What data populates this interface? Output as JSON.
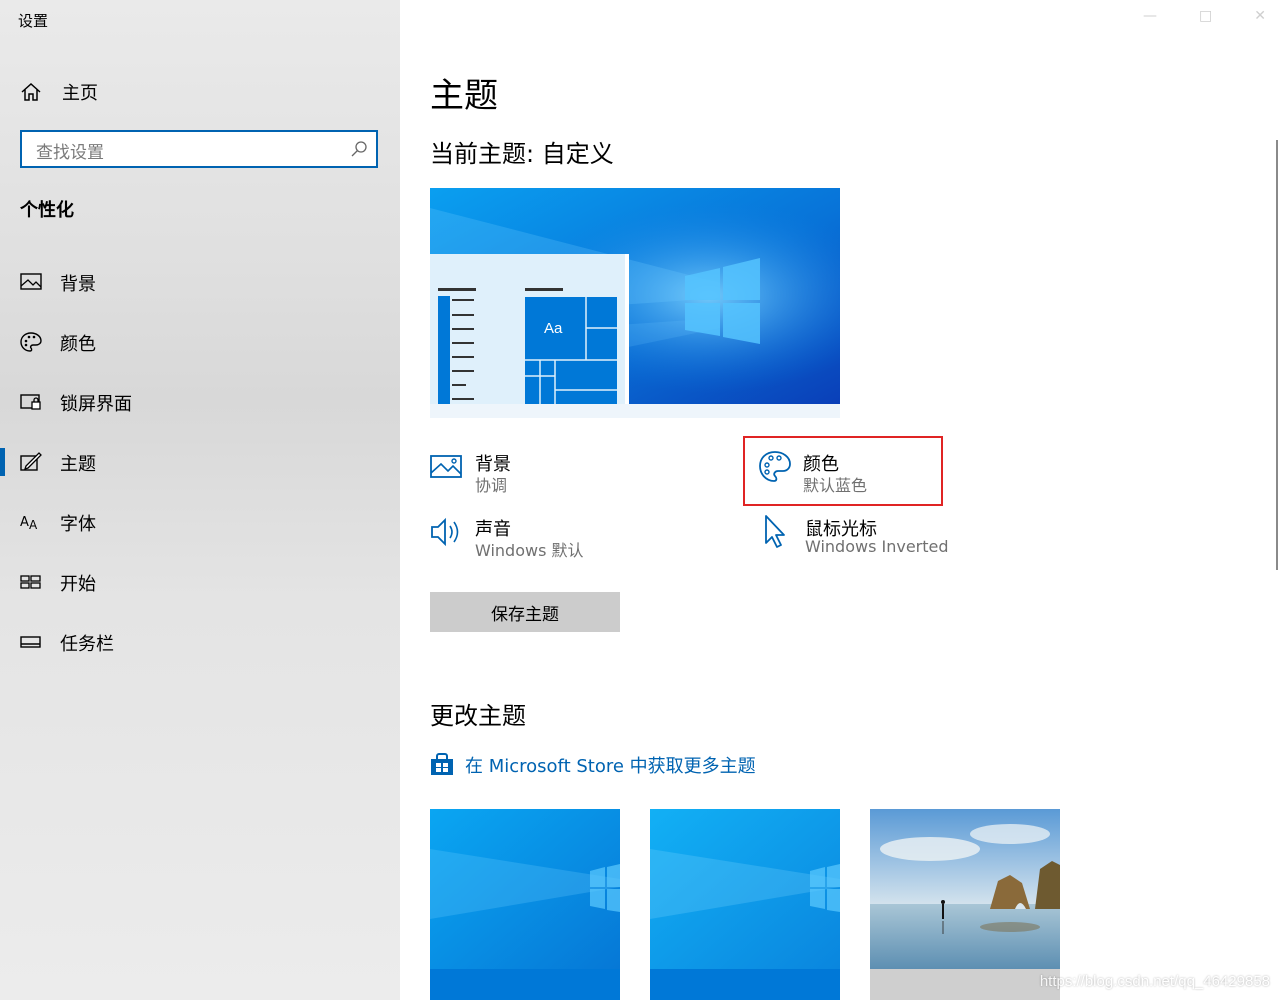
{
  "window": {
    "title": "设置"
  },
  "sidebar": {
    "home_label": "主页",
    "search_placeholder": "查找设置",
    "section_title": "个性化",
    "items": [
      {
        "label": "背景",
        "icon": "image-icon"
      },
      {
        "label": "颜色",
        "icon": "palette-icon"
      },
      {
        "label": "锁屏界面",
        "icon": "lock-screen-icon"
      },
      {
        "label": "主题",
        "icon": "theme-icon",
        "active": true
      },
      {
        "label": "字体",
        "icon": "font-icon"
      },
      {
        "label": "开始",
        "icon": "start-icon"
      },
      {
        "label": "任务栏",
        "icon": "taskbar-icon"
      }
    ]
  },
  "main": {
    "title": "主题",
    "current_theme": "当前主题: 自定义",
    "preview_sample_text": "Aa",
    "properties": [
      {
        "title": "背景",
        "value": "协调",
        "icon": "image-icon"
      },
      {
        "title": "颜色",
        "value": "默认蓝色",
        "icon": "palette-icon"
      },
      {
        "title": "声音",
        "value": "Windows 默认",
        "icon": "speaker-icon"
      },
      {
        "title": "鼠标光标",
        "value": "Windows Inverted",
        "icon": "cursor-icon"
      }
    ],
    "save_button": "保存主题",
    "change_title": "更改主题",
    "store_link": "在 Microsoft Store 中获取更多主题"
  },
  "watermark": "https://blog.csdn.net/qq_46429858",
  "colors": {
    "accent": "#0063b1",
    "highlight": "#e02424",
    "sidebar_bg": "#e6e6e6"
  }
}
